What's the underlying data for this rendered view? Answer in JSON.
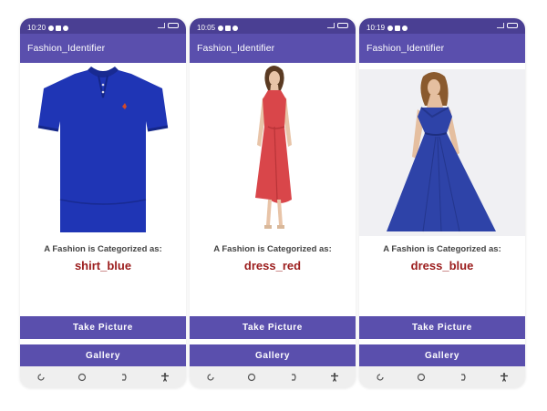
{
  "screens": [
    {
      "status_time": "10:20",
      "app_title": "Fashion_Identifier",
      "image_subject": "blue polo shirt",
      "category_label": "A Fashion is Categorized as:",
      "category_value": "shirt_blue",
      "take_picture_label": "Take Picture",
      "gallery_label": "Gallery"
    },
    {
      "status_time": "10:05",
      "app_title": "Fashion_Identifier",
      "image_subject": "red halter dress",
      "category_label": "A Fashion is Categorized as:",
      "category_value": "dress_red",
      "take_picture_label": "Take Picture",
      "gallery_label": "Gallery"
    },
    {
      "status_time": "10:19",
      "app_title": "Fashion_Identifier",
      "image_subject": "blue evening gown",
      "category_label": "A Fashion is Categorized as:",
      "category_value": "dress_blue",
      "take_picture_label": "Take Picture",
      "gallery_label": "Gallery"
    }
  ],
  "colors": {
    "status_bar": "#4a3f93",
    "app_bar": "#5a4fad",
    "button": "#5a4fad",
    "category_value": "#9b1c1c",
    "nav_bar": "#efefef"
  },
  "nav_icons": [
    "recent-apps-icon",
    "home-icon",
    "back-icon",
    "accessibility-icon"
  ]
}
